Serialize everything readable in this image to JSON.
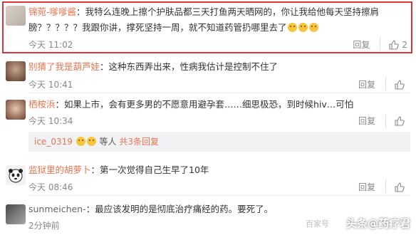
{
  "comments": [
    {
      "username": "锦菀-嗲嗲酱",
      "text_line1": "：我特么连晚上擦个护肤品都三天打鱼两天晒网的，你让我给他每天坚持擦肩",
      "text_line2": "膀？？？？？我跟你讲，撑死坚持一周，就不知道药管扔哪里去了",
      "time": "今天 11:02",
      "reply_label": "回复",
      "likes": "2"
    },
    {
      "username": "别猜了我是葫芦娃",
      "text_line1": "：这种东西弄出来，性病我估计是控制不住了",
      "time": "今天 10:41",
      "reply_label": "回复",
      "likes": ""
    },
    {
      "username": "栖桉浜",
      "text_line1": "：如果上市，会有更多男的不愿意用避孕套……细思极恐，到时候hiv…可怕",
      "time": "今天 10:34",
      "reply_label": "回复",
      "likes": ""
    },
    {
      "username": "监狱里的胡萝卜",
      "text_line1": "：第一次觉得自己生早了10年",
      "time": "今天 08:46",
      "reply_label": "回复",
      "likes": ""
    },
    {
      "username": "sunmeichen-",
      "text_line1": "：最应该发明的是彻底治疗痛经的药。要死了。",
      "time": "2分钟前",
      "reply_label": "",
      "likes": ""
    }
  ],
  "sub_reply": {
    "name": "ice_0319",
    "middle": "等人",
    "count": "共3条回复"
  },
  "watermark": {
    "main": "头条@药疗君",
    "faint": "百家号"
  },
  "colors": {
    "username": "#eb7350",
    "highlight_border": "#d9343a",
    "meta": "#888888"
  }
}
